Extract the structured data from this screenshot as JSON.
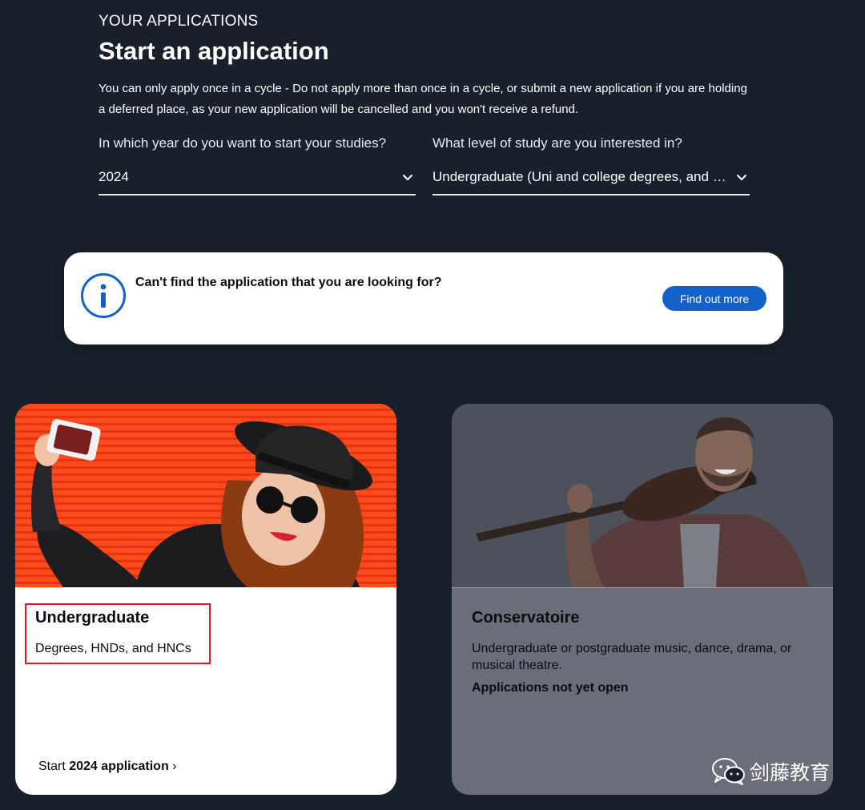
{
  "header": {
    "eyebrow": "YOUR APPLICATIONS",
    "title": "Start an application",
    "notice": "You can only apply once in a cycle - Do not apply more than once in a cycle, or submit a new application if you are holding a deferred place, as your new application will be cancelled and you won't receive a refund."
  },
  "year_select": {
    "label": "In which year do you want to start your studies?",
    "value": "2024"
  },
  "level_select": {
    "label": "What level of study are you interested in?",
    "value": "Undergraduate (Uni and college degrees, and apprenticeships)"
  },
  "info_banner": {
    "text": "Can't find the application that you are looking for?",
    "button_label": "Find out more",
    "icon": "info-circle-icon"
  },
  "cards": {
    "undergraduate": {
      "title": "Undergraduate",
      "description": "Degrees, HNDs, and HNCs",
      "link_prefix": "Start ",
      "link_bold": "2024 application",
      "link_suffix": " ›"
    },
    "conservatoire": {
      "title": "Conservatoire",
      "description": "Undergraduate or postgraduate music, dance, drama, or musical theatre.",
      "status": "Applications not yet open"
    }
  },
  "watermark": {
    "text": "剑藤教育",
    "icon": "wechat-icon"
  },
  "colors": {
    "page_background": "#1a202b",
    "primary_button": "#1261c8",
    "info_icon": "#1261c8",
    "undergraduate_image_background": "#ff4a1c",
    "conservatoire_card": "#6b6e79",
    "highlight_border": "#e0181f"
  }
}
